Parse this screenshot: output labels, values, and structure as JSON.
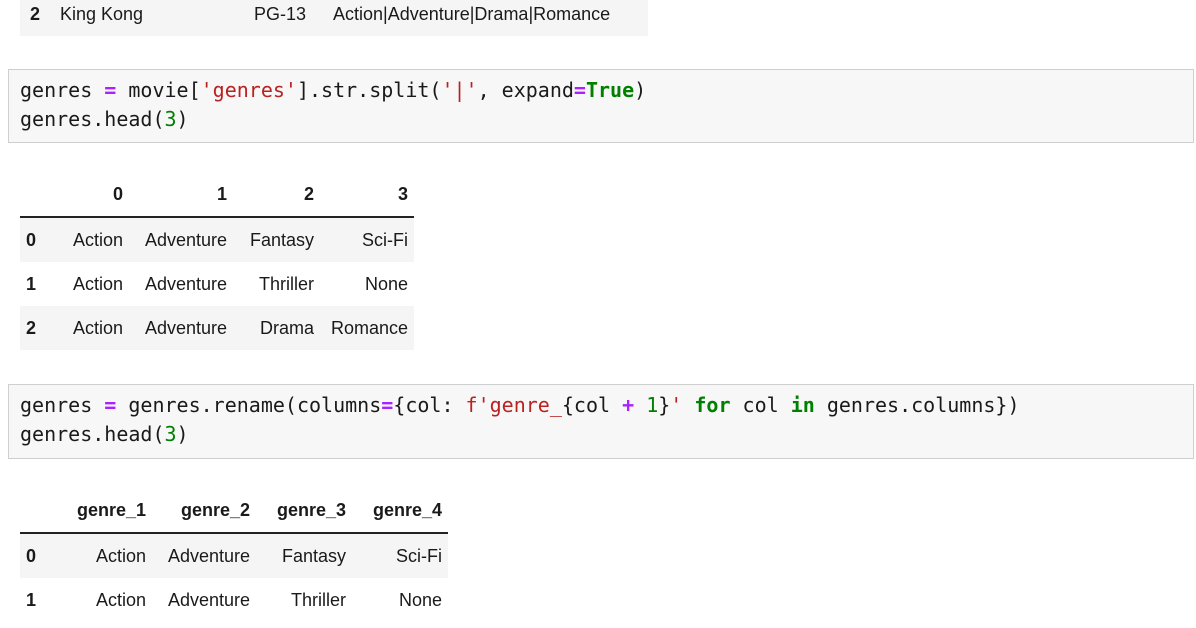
{
  "top_row": {
    "index": "2",
    "title": "King Kong",
    "rating": "PG-13",
    "genres": "Action|Adventure|Drama|Romance"
  },
  "cell1": {
    "line1": {
      "var": "genres ",
      "op": "=",
      "mid": " movie[",
      "str1": "'genres'",
      "mid2": "].str.split(",
      "str2": "'|'",
      "mid3": ", expand",
      "op2": "=",
      "kw": "True",
      "end": ")"
    },
    "line2": {
      "pre": "genres.head(",
      "num": "3",
      "end": ")"
    }
  },
  "table1": {
    "columns": [
      "0",
      "1",
      "2",
      "3"
    ],
    "rows": [
      {
        "index": "0",
        "cells": [
          "Action",
          "Adventure",
          "Fantasy",
          "Sci-Fi"
        ]
      },
      {
        "index": "1",
        "cells": [
          "Action",
          "Adventure",
          "Thriller",
          "None"
        ]
      },
      {
        "index": "2",
        "cells": [
          "Action",
          "Adventure",
          "Drama",
          "Romance"
        ]
      }
    ]
  },
  "cell2": {
    "line1": {
      "var": "genres ",
      "op": "=",
      "mid": " genres.rename(columns",
      "op2": "=",
      "mid2": "{col: ",
      "str1": "f'genre_",
      "mid3": "{col ",
      "op3": "+",
      "sp": " ",
      "num": "1",
      "mid4": "}",
      "str2": "'",
      "sp2": " ",
      "kw1": "for",
      "mid5": " col ",
      "kw2": "in",
      "end": " genres.columns})"
    },
    "line2": {
      "pre": "genres.head(",
      "num": "3",
      "end": ")"
    }
  },
  "table2": {
    "columns": [
      "genre_1",
      "genre_2",
      "genre_3",
      "genre_4"
    ],
    "rows": [
      {
        "index": "0",
        "cells": [
          "Action",
          "Adventure",
          "Fantasy",
          "Sci-Fi"
        ]
      },
      {
        "index": "1",
        "cells": [
          "Action",
          "Adventure",
          "Thriller",
          "None"
        ]
      }
    ]
  }
}
